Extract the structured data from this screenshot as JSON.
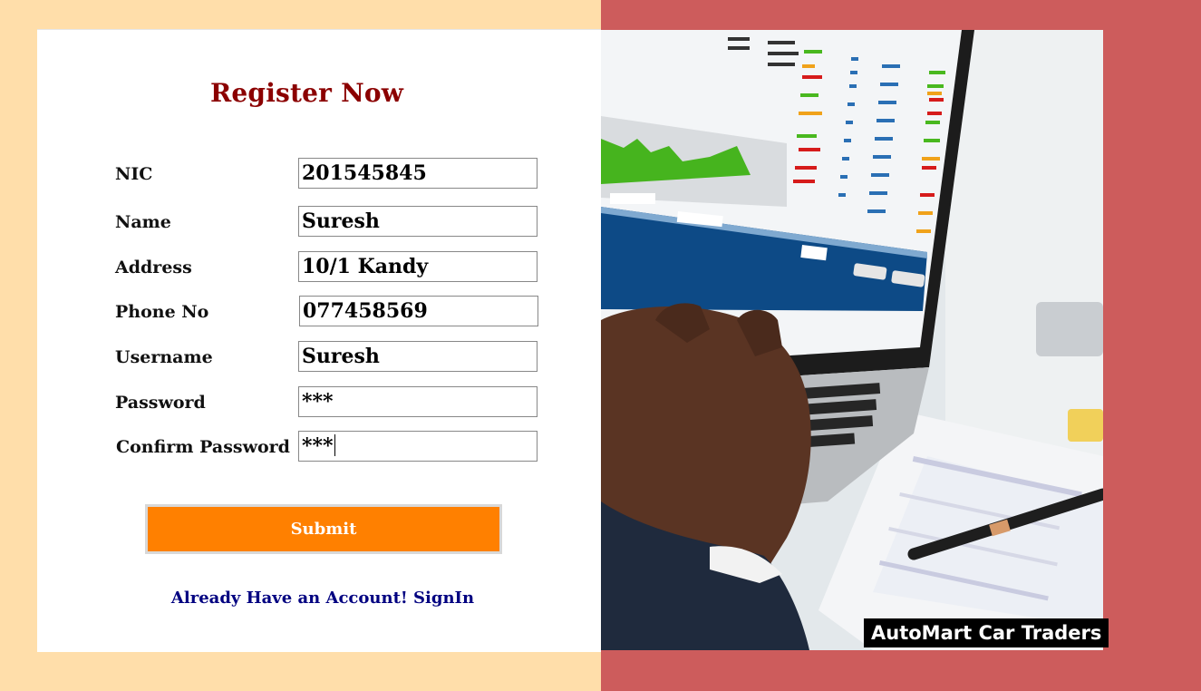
{
  "form": {
    "title": "Register Now",
    "fields": [
      {
        "label": "NIC",
        "value": "201545845"
      },
      {
        "label": "Name",
        "value": "Suresh"
      },
      {
        "label": "Address",
        "value": "10/1 Kandy"
      },
      {
        "label": "Phone No",
        "value": "077458569"
      },
      {
        "label": "Username",
        "value": "Suresh"
      },
      {
        "label": "Password",
        "value": "***"
      },
      {
        "label": "Confirm Password",
        "value": "***"
      }
    ],
    "submit_label": "Submit",
    "signin_link": "Already Have an Account! SignIn"
  },
  "hero": {
    "brand": "AutoMart Car Traders"
  },
  "colors": {
    "left_bg": "#ffdeaa",
    "right_bg": "#cd5c5c",
    "title": "#8b0000",
    "submit_bg": "#ff8000",
    "link": "#000080"
  }
}
